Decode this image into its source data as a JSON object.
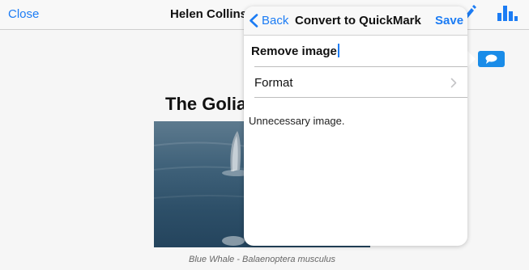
{
  "navbar": {
    "close_label": "Close",
    "title": "Helen Collins",
    "edit_icon": "pencil-icon",
    "chart_icon": "bar-chart-icon"
  },
  "article": {
    "title": "The Goliath",
    "image_caption": "Blue Whale - Balaenoptera musculus"
  },
  "comment_badge": {
    "icon": "speech-bubble-icon",
    "color": "#1a8ce8"
  },
  "popover": {
    "back_label": "Back",
    "title": "Convert to QuickMark",
    "save_label": "Save",
    "name_value": "Remove image",
    "format_label": "Format",
    "note": "Unnecessary image."
  },
  "colors": {
    "accent": "#1c7cf4"
  }
}
